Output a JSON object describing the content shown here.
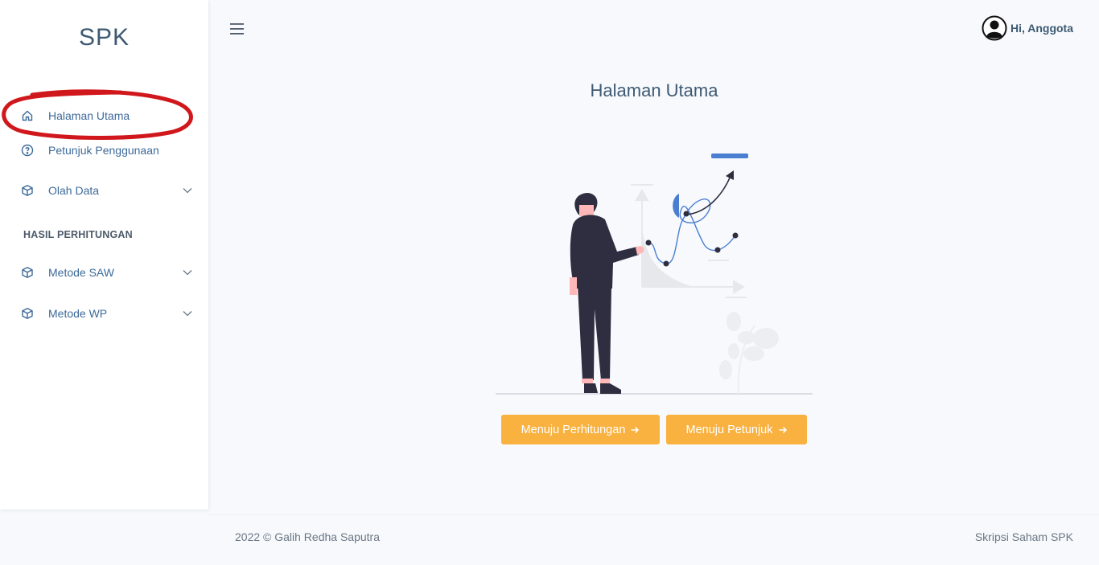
{
  "brand": {
    "title": "SPK"
  },
  "sidebar": {
    "items": [
      {
        "label": "Halaman Utama",
        "icon": "home-icon"
      },
      {
        "label": "Petunjuk Penggunaan",
        "icon": "question-circle-icon"
      },
      {
        "label": "Olah Data",
        "icon": "cube-icon",
        "expandable": true
      }
    ],
    "section_title": "HASIL PERHITUNGAN",
    "section_items": [
      {
        "label": "Metode SAW",
        "icon": "cube-icon",
        "expandable": true
      },
      {
        "label": "Metode WP",
        "icon": "cube-icon",
        "expandable": true
      }
    ],
    "active_index": 0
  },
  "header": {
    "user_greeting": "Hi, Anggota"
  },
  "main": {
    "title": "Halaman Utama",
    "buttons": [
      {
        "label": "Menuju Perhitungan",
        "icon": "arrow-right-icon"
      },
      {
        "label": "Menuju Petunjuk",
        "icon": "arrow-right-icon"
      }
    ]
  },
  "footer": {
    "left": "2022 © Galih Redha Saputra",
    "right": "Skripsi Saham SPK"
  },
  "colors": {
    "accent_button": "#f9b13f",
    "nav_text": "#3d6a9a",
    "annotation_ring": "#d0181c",
    "illustration_blue": "#4a7ed1",
    "figure_dark": "#2f2e41"
  }
}
